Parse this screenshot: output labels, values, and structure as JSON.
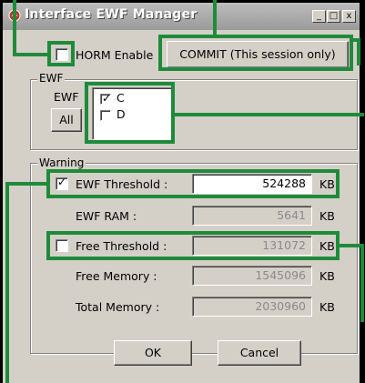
{
  "window": {
    "title": "Interface EWF Manager",
    "minimize_glyph": "_",
    "maximize_glyph": "□",
    "close_glyph": "x"
  },
  "horm": {
    "label": "HORM Enable",
    "checked": false
  },
  "commit_button": "COMMIT (This session only)",
  "ewf_group": {
    "title": "EWF",
    "label": "EWF",
    "all_button": "All",
    "drives": [
      {
        "label": "C",
        "checked": true
      },
      {
        "label": "D",
        "checked": false
      }
    ]
  },
  "warning_group": {
    "title": "Warning",
    "ewf_threshold": {
      "label": "EWF Threshold :",
      "checked": true,
      "value": "524288",
      "unit": "KB"
    },
    "ewf_ram": {
      "label": "EWF RAM :",
      "value": "5641",
      "unit": "KB"
    },
    "free_threshold": {
      "label": "Free Threshold :",
      "checked": false,
      "value": "131072",
      "unit": "KB"
    },
    "free_memory": {
      "label": "Free Memory :",
      "value": "1545096",
      "unit": "KB"
    },
    "total_memory": {
      "label": "Total Memory :",
      "value": "2030960",
      "unit": "KB"
    }
  },
  "ok_button": "OK",
  "cancel_button": "Cancel",
  "colors": {
    "highlight": "#1f8b3a",
    "dialog": "#d4d0c8"
  }
}
